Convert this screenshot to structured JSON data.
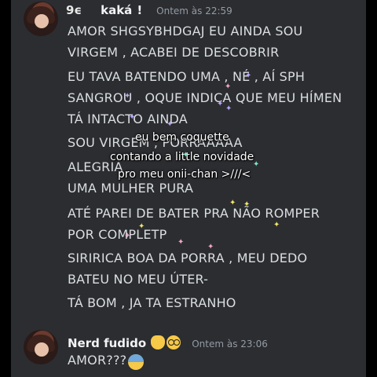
{
  "message1": {
    "prefix": "9ϵ",
    "username": "kaká",
    "badge": "!",
    "timestamp": "Ontem às 22:59",
    "lines": [
      "AMOR SHGSYBHDGAJ EU AINDA SOU",
      "VIRGEM , ACABEI DE DESCOBRIR",
      "EU TAVA BATENDO UMA , NÉ , AÍ SPH",
      "SANGROU , OQUE INDICA QUE MEU HÍMEN",
      "TÁ INTACTO AINDA",
      "SOU VIRGEM , PORRAAAAA",
      "ALEGRIA",
      "UMA MULHER PURA",
      "ATÉ PAREI DE BATER PRA NÃO ROMPER",
      "POR COMPLETP",
      "SIRIRICA BOA DA PORRA , MEU DEDO",
      "BATEU NO MEU ÚTER-",
      "TÁ BOM , JA TA ESTRANHO"
    ]
  },
  "message2": {
    "username": "Nerd fudido",
    "emojis": [
      "raised-finger-emoji",
      "nerd-face-emoji"
    ],
    "timestamp": "Ontem às 23:06",
    "text": "AMOR???",
    "trailing_emoji": "anxious-sweat-emoji"
  },
  "overlay": {
    "lines": [
      "eu bem coquette",
      "contando a little novidade",
      "pro meu onii-chan >///<"
    ]
  },
  "colors": {
    "background": "#2b2d31",
    "text": "#dbdee1",
    "username": "#f2f3f5",
    "timestamp": "#949ba4",
    "star_yellow": "#f4e36b",
    "star_pink": "#f1a7c7",
    "star_purple": "#b9a3f5",
    "star_teal": "#7fe3c9"
  }
}
